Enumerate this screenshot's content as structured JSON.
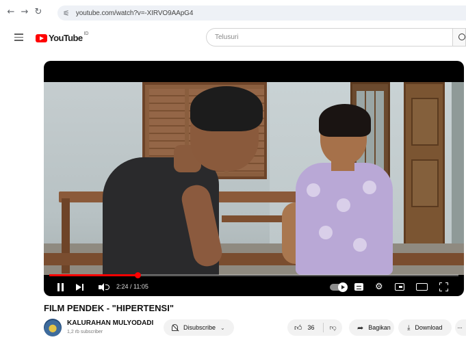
{
  "browser": {
    "url": "youtube.com/watch?v=-XIRVO9AApG4",
    "icons": [
      "back-arrow-icon",
      "forward-arrow-icon",
      "reload-icon",
      "site-settings-icon"
    ]
  },
  "header": {
    "logo_text": "YouTube",
    "region_code": "ID",
    "search_placeholder": "Telusuri",
    "brand_color": "#ff0000"
  },
  "player": {
    "time_display": "2:24 / 11:05",
    "progress_fraction": 0.216,
    "progress_color": "#ff0000",
    "controls": [
      "pause-icon",
      "next-icon",
      "volume-icon",
      "autoplay-toggle",
      "subtitles-icon",
      "settings-icon",
      "miniplayer-icon",
      "theater-icon",
      "fullscreen-icon"
    ]
  },
  "video": {
    "title": "FILM PENDEK - \"HIPERTENSI\""
  },
  "channel": {
    "name": "KALURAHAN MULYODADI",
    "subscribers": "1,2 rb subscriber"
  },
  "actions": {
    "subscribe_label": "Disubscribe",
    "like_count": "36",
    "share_label": "Bagikan",
    "download_label": "Download"
  }
}
